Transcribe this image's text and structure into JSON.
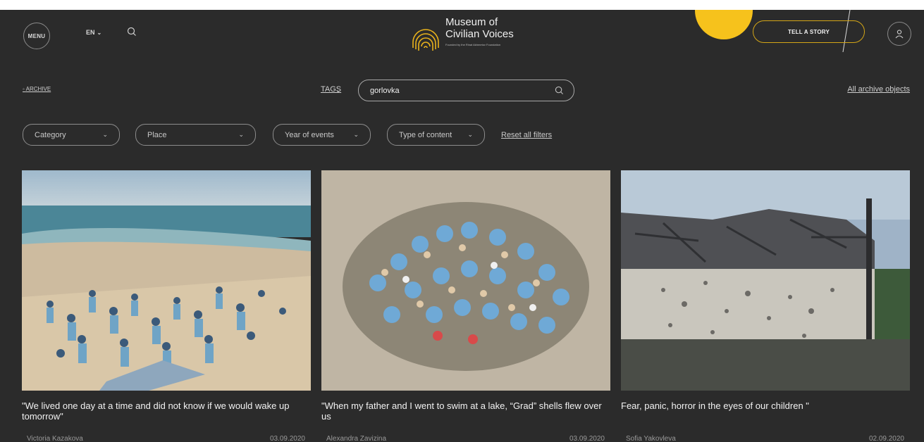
{
  "header": {
    "menu_label": "MENU",
    "lang_label": "EN",
    "logo_title_line1": "Museum of",
    "logo_title_line2": "Civilian Voices",
    "logo_subtitle": "Founded by the Rinat Akhmetov Foundation",
    "tell_story_label": "TELL A STORY",
    "accent_color": "#f6c21c"
  },
  "toolbar": {
    "archive_label": "ARCHIVE",
    "tags_label": "TAGS",
    "search_value": "gorlovka",
    "all_archive_label": "All archive objects"
  },
  "filters": {
    "category": "Category",
    "place": "Place",
    "year": "Year of events",
    "type": "Type of content",
    "reset": "Reset all filters"
  },
  "cards": [
    {
      "title": "\"We lived one day at a time and did not know if we would wake up tomorrow\"",
      "author": "Victoria Kazakova",
      "date": "03.09.2020"
    },
    {
      "title": "\"When my father and I went to swim at a lake, “Grad” shells flew over us",
      "author": "Alexandra Zavizina",
      "date": "03.09.2020"
    },
    {
      "title": "Fear, panic, horror in the eyes of our children \"",
      "author": "Sofia Yakovleva",
      "date": "02.09.2020"
    }
  ]
}
